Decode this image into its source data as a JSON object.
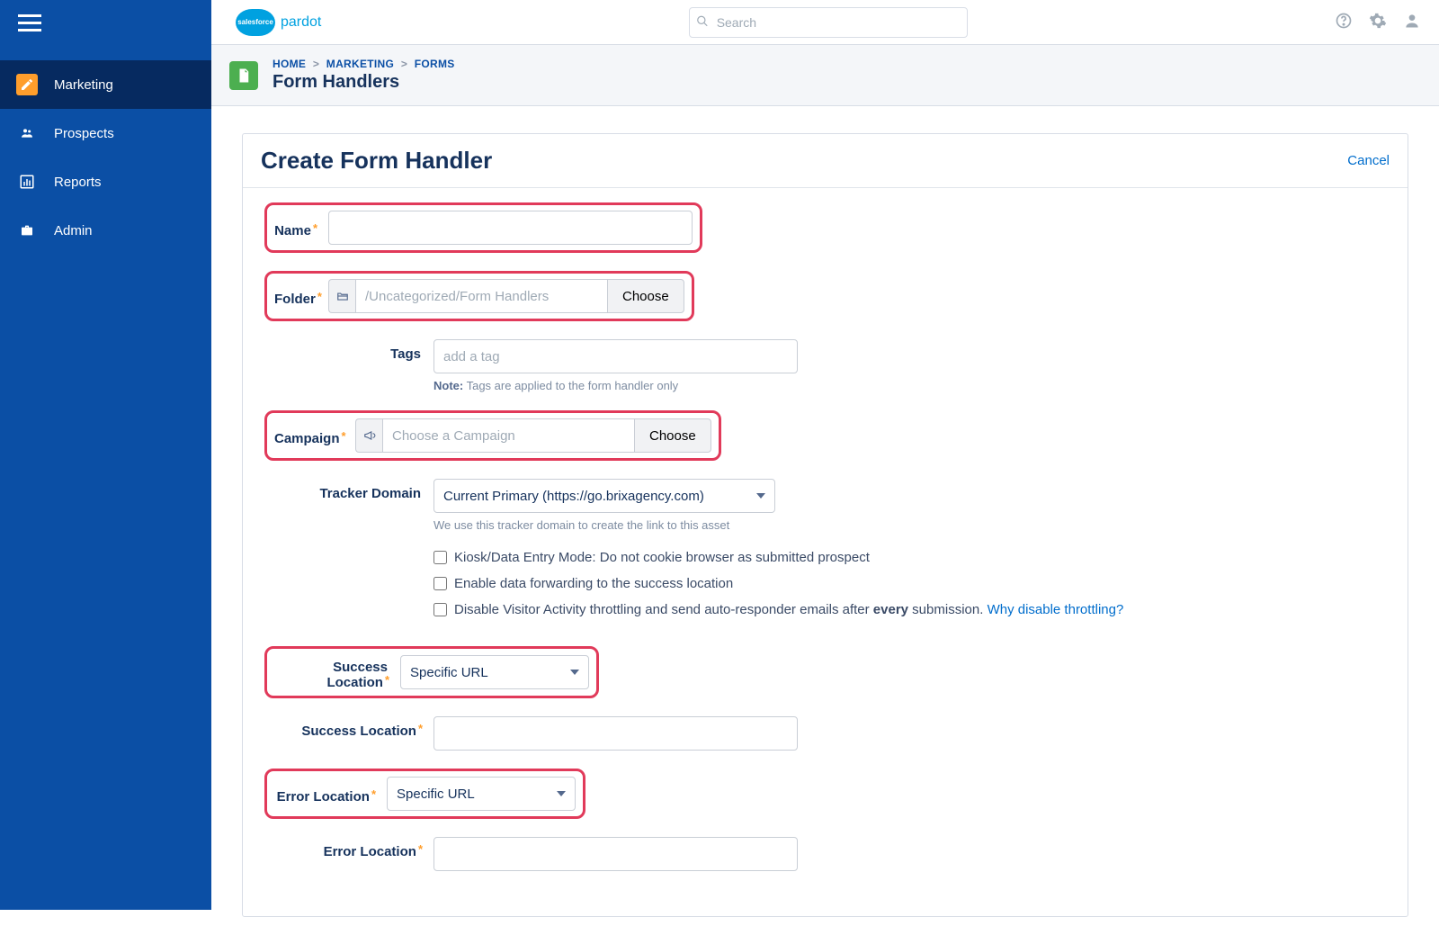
{
  "app": {
    "brand_cloud": "salesforce",
    "brand_text": "pardot"
  },
  "search": {
    "placeholder": "Search"
  },
  "sidebar": {
    "items": [
      {
        "label": "Marketing"
      },
      {
        "label": "Prospects"
      },
      {
        "label": "Reports"
      },
      {
        "label": "Admin"
      }
    ]
  },
  "breadcrumb": {
    "home": "HOME",
    "marketing": "MARKETING",
    "forms": "FORMS",
    "title": "Form Handlers"
  },
  "card": {
    "title": "Create Form Handler",
    "cancel": "Cancel"
  },
  "form": {
    "name_label": "Name",
    "folder_label": "Folder",
    "folder_value": "/Uncategorized/Form Handlers",
    "choose": "Choose",
    "tags_label": "Tags",
    "tags_placeholder": "add a tag",
    "tags_note_bold": "Note:",
    "tags_note_rest": " Tags are applied to the form handler only",
    "campaign_label": "Campaign",
    "campaign_placeholder": "Choose a Campaign",
    "tracker_label": "Tracker Domain",
    "tracker_value": "Current Primary (https://go.brixagency.com)",
    "tracker_note": "We use this tracker domain to create the link to this asset",
    "cb_kiosk": "Kiosk/Data Entry Mode: Do not cookie browser as submitted prospect",
    "cb_forward": "Enable data forwarding to the success location",
    "cb_throttle_pre": "Disable Visitor Activity throttling and send auto-responder emails after ",
    "cb_throttle_bold": "every",
    "cb_throttle_post": " submission. ",
    "cb_throttle_link": "Why disable throttling?",
    "success_loc_label": "Success Location",
    "success_loc_value": "Specific URL",
    "success_loc_url_label": "Success Location",
    "error_loc_label": "Error Location",
    "error_loc_value": "Specific URL",
    "error_loc_url_label": "Error Location"
  }
}
